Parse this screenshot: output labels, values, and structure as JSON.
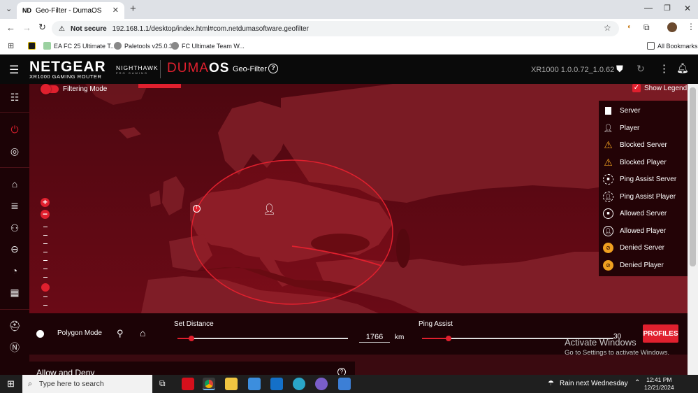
{
  "browser": {
    "tab_title": "Geo-Filter - DumaOS",
    "tab_favicon": "ND",
    "security_label": "Not secure",
    "url": "192.168.1.1/desktop/index.html#com.netdumasoftware.geofilter",
    "bookmarks": [
      "EA FC 25 Ultimate T...",
      "Paletools v25.0.3",
      "FC Ultimate Team W..."
    ],
    "all_bookmarks_label": "All Bookmarks"
  },
  "app": {
    "brand": "NETGEAR",
    "model": "XR1000 GAMING ROUTER",
    "nighthawk": "NIGHTHAWK",
    "nighthawk_sub": "PRO GAMING",
    "duma_prefix": "DUMA",
    "duma_suffix": "OS",
    "page_title": "Geo-Filter",
    "version": "XR1000 1.0.0.72_1.0.62"
  },
  "map": {
    "filtering_mode_label": "Filtering Mode",
    "show_legend_label": "Show Legend",
    "show_legend_checked": true
  },
  "legend": [
    {
      "label": "Server",
      "icon": "server-icon"
    },
    {
      "label": "Player",
      "icon": "player-icon"
    },
    {
      "label": "Blocked Server",
      "icon": "blocked-server-icon"
    },
    {
      "label": "Blocked Player",
      "icon": "blocked-player-icon"
    },
    {
      "label": "Ping Assist Server",
      "icon": "ping-assist-server-icon"
    },
    {
      "label": "Ping Assist Player",
      "icon": "ping-assist-player-icon"
    },
    {
      "label": "Allowed Server",
      "icon": "allowed-server-icon"
    },
    {
      "label": "Allowed Player",
      "icon": "allowed-player-icon"
    },
    {
      "label": "Denied Server",
      "icon": "denied-server-icon"
    },
    {
      "label": "Denied Player",
      "icon": "denied-player-icon"
    }
  ],
  "controls": {
    "polygon_mode_label": "Polygon Mode",
    "set_distance_label": "Set Distance",
    "distance_value": "1766",
    "distance_unit": "km",
    "distance_fraction": 0.08,
    "ping_assist_label": "Ping Assist",
    "ping_assist_value": "30",
    "ping_assist_fraction": 0.14,
    "profiles_button": "PROFILES",
    "allow_deny_title": "Allow and Deny"
  },
  "watermark": {
    "line1": "Activate Windows",
    "line2": "Go to Settings to activate Windows."
  },
  "taskbar": {
    "search_placeholder": "Type here to search",
    "weather": "Rain next Wednesday",
    "time": "12:41 PM",
    "date": "12/21/2024"
  },
  "colors": {
    "accent": "#e0202e",
    "map_background": "#5a0812",
    "header_background": "#0a0a0a"
  }
}
